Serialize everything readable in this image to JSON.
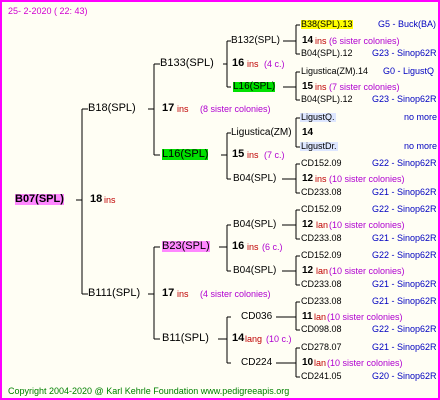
{
  "header": "25-  2-2020 ( 22: 43)",
  "footer": "Copyright 2004-2020 @ Karl Kehrle Foundation    www.pedigreeapis.org",
  "gen0": {
    "name": "B07(SPL)",
    "num": "18",
    "ins": "ins"
  },
  "gen1": [
    {
      "name": "B18(SPL)",
      "num": "17",
      "ins": "ins",
      "sis": "(8 sister colonies)"
    },
    {
      "name": "B111(SPL)",
      "num": "17",
      "ins": "ins",
      "sis": "(4 sister colonies)"
    }
  ],
  "gen2": [
    {
      "name": "B133(SPL)",
      "num": "16",
      "ins": "ins",
      "sis": "(4 c.)"
    },
    {
      "name": "L16(SPL)",
      "num": "15",
      "ins": "ins",
      "sis": "(7 c.)"
    },
    {
      "name": "B23(SPL)",
      "num": "16",
      "ins": "ins",
      "sis": "(6 c.)"
    },
    {
      "name": "B11(SPL)",
      "num": "14",
      "ins": "lang",
      "sis": "(10 c.)"
    }
  ],
  "gen3": [
    {
      "name": "B132(SPL)",
      "num": "14",
      "ins": "ins",
      "sis": "(6 sister colonies)"
    },
    {
      "name": "L16(SPL)",
      "num": "15",
      "ins": "ins",
      "sis": "(7 sister colonies)"
    },
    {
      "name": "Ligustica(ZM)",
      "num": "14",
      "ins": "",
      "sis": ""
    },
    {
      "name": "B04(SPL)",
      "num": "12",
      "ins": "ins",
      "sis": "(10 sister colonies)"
    },
    {
      "name": "B04(SPL)",
      "num": "12",
      "ins": "lan",
      "sis": "(10 sister colonies)"
    },
    {
      "name": "B04(SPL)",
      "num": "12",
      "ins": "lan",
      "sis": "(10 sister colonies)"
    },
    {
      "name": "CD036",
      "num": "11",
      "ins": "lan",
      "sis": "(10 sister colonies)"
    },
    {
      "name": "CD224",
      "num": "10",
      "ins": "lan",
      "sis": "(10 sister colonies)"
    }
  ],
  "gen4": [
    {
      "name": "B38(SPL).13",
      "info": "G5 - Buck(BA)"
    },
    {
      "name": "B04(SPL).12",
      "info": "G23 - Sinop62R"
    },
    {
      "name": "Ligustica(ZM).14",
      "info": "G0 - LigustQ"
    },
    {
      "name": "B04(SPL).12",
      "info": "G23 - Sinop62R"
    },
    {
      "name": "LigustQ.",
      "info": "no more"
    },
    {
      "name": "LigustDr.",
      "info": "no more"
    },
    {
      "name": "CD152.09",
      "info": "G22 - Sinop62R"
    },
    {
      "name": "CD233.08",
      "info": "G21 - Sinop62R"
    },
    {
      "name": "CD152.09",
      "info": "G22 - Sinop62R"
    },
    {
      "name": "CD233.08",
      "info": "G21 - Sinop62R"
    },
    {
      "name": "CD152.09",
      "info": "G22 - Sinop62R"
    },
    {
      "name": "CD233.08",
      "info": "G21 - Sinop62R"
    },
    {
      "name": "CD233.08",
      "info": "G21 - Sinop62R"
    },
    {
      "name": "CD098.08",
      "info": "G22 - Sinop62R"
    },
    {
      "name": "CD278.07",
      "info": "G21 - Sinop62R"
    },
    {
      "name": "CD241.05",
      "info": "G20 - Sinop62R"
    }
  ],
  "colors": {
    "border": "#ff00ff",
    "highlight_pink": "#ff88ff",
    "highlight_green": "#00e000",
    "highlight_yellow": "#ffff00",
    "ins": "#c00000",
    "sister": "#b000d0",
    "info": "#0000c0",
    "footer": "#008000"
  }
}
